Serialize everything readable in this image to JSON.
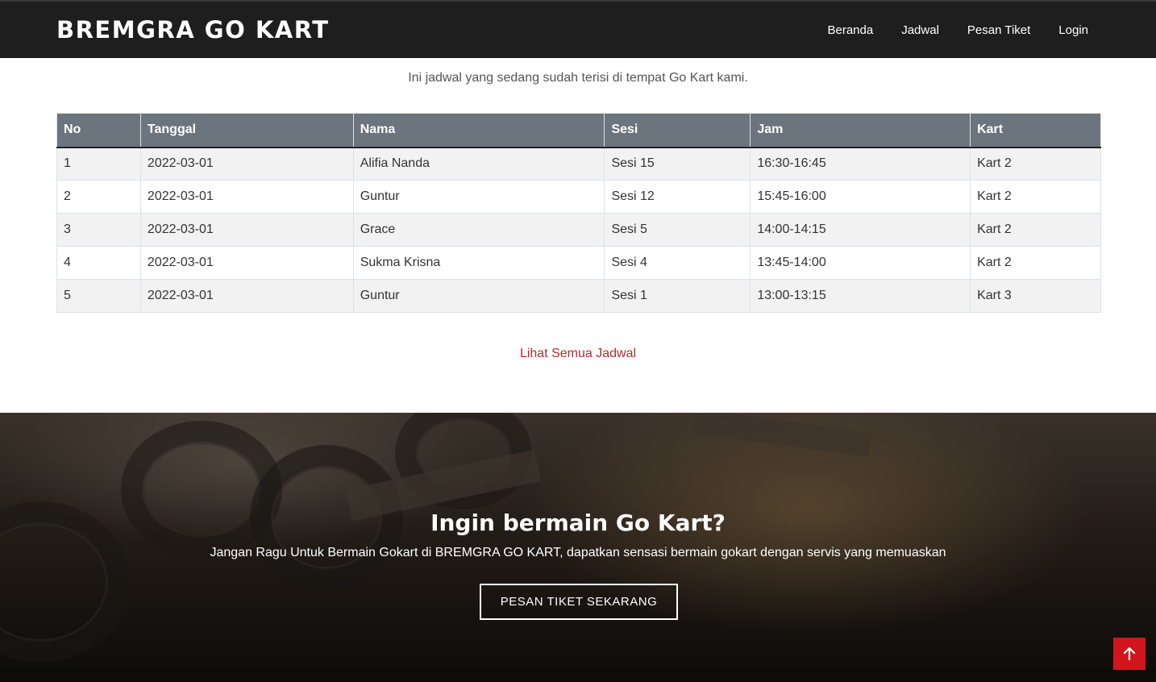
{
  "navbar": {
    "brand": "BREMGRA GO KART",
    "links": [
      "Beranda",
      "Jadwal",
      "Pesan Tiket",
      "Login"
    ]
  },
  "schedule": {
    "intro": "Ini jadwal yang sedang sudah terisi di tempat Go Kart kami.",
    "columns": [
      "No",
      "Tanggal",
      "Nama",
      "Sesi",
      "Jam",
      "Kart"
    ],
    "rows": [
      [
        "1",
        "2022-03-01",
        "Alifia Nanda",
        "Sesi 15",
        "16:30-16:45",
        "Kart 2"
      ],
      [
        "2",
        "2022-03-01",
        "Guntur",
        "Sesi 12",
        "15:45-16:00",
        "Kart 2"
      ],
      [
        "3",
        "2022-03-01",
        "Grace",
        "Sesi 5",
        "14:00-14:15",
        "Kart 2"
      ],
      [
        "4",
        "2022-03-01",
        "Sukma Krisna",
        "Sesi 4",
        "13:45-14:00",
        "Kart 2"
      ],
      [
        "5",
        "2022-03-01",
        "Guntur",
        "Sesi 1",
        "13:00-13:15",
        "Kart 3"
      ]
    ],
    "see_all": "Lihat Semua Jadwal"
  },
  "cta": {
    "title": "Ingin bermain Go Kart?",
    "subtitle": "Jangan Ragu Untuk Bermain Gokart di BREMGRA GO KART, dapatkan sensasi bermain gokart dengan servis yang memuaskan",
    "button": "PESAN TIKET SEKARANG"
  },
  "back_to_top": {
    "icon": "arrow-up-icon"
  },
  "colors": {
    "navbar": "#1e1e1e",
    "table_header": "#6c757d",
    "link": "#b22b33",
    "back_to_top": "#d0161c"
  }
}
